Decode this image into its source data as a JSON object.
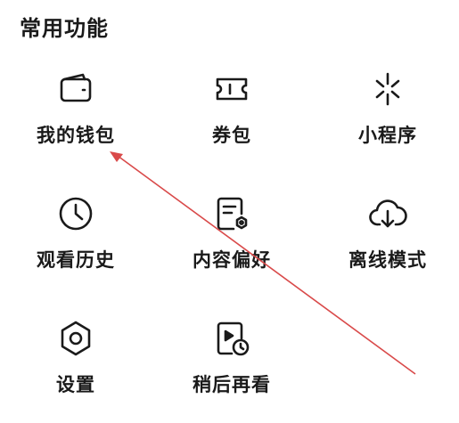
{
  "section": {
    "title": "常用功能"
  },
  "items": [
    {
      "label": "我的钱包",
      "icon": "wallet-icon"
    },
    {
      "label": "券包",
      "icon": "ticket-icon"
    },
    {
      "label": "小程序",
      "icon": "mini-program-icon"
    },
    {
      "label": "观看历史",
      "icon": "clock-icon"
    },
    {
      "label": "内容偏好",
      "icon": "document-settings-icon"
    },
    {
      "label": "离线模式",
      "icon": "cloud-download-icon"
    },
    {
      "label": "设置",
      "icon": "gear-icon"
    },
    {
      "label": "稍后再看",
      "icon": "watch-later-icon"
    }
  ],
  "colors": {
    "text": "#1a1a1a",
    "icon_stroke": "#1a1a1a",
    "annotation_arrow": "#d94a4a"
  }
}
